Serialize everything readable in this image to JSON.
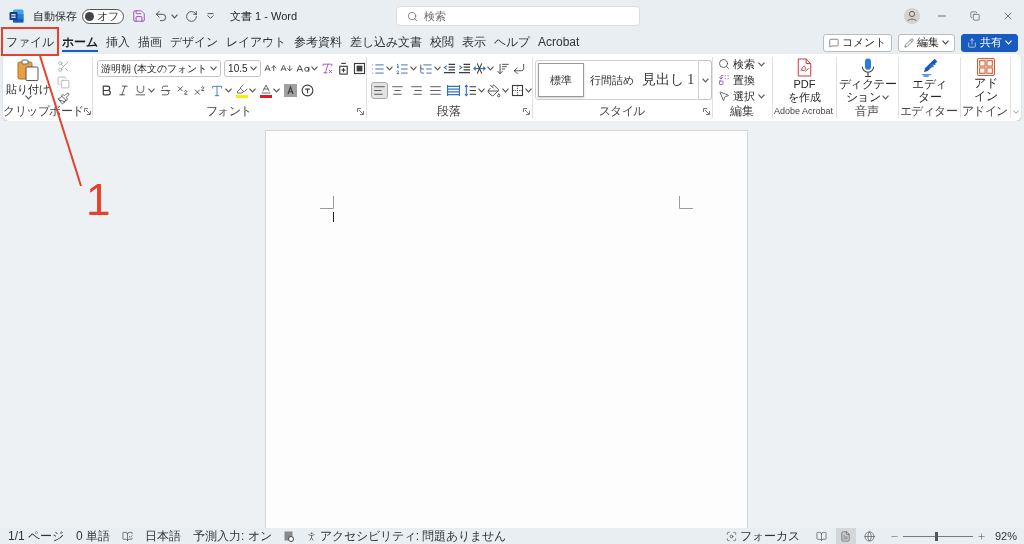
{
  "title_bar": {
    "autosave": {
      "label": "自動保存",
      "on": false,
      "state_text": "オフ"
    },
    "document_title": "文書 1 - Word",
    "search": {
      "placeholder": "検索"
    }
  },
  "tabs": [
    {
      "label": "ファイル",
      "selected": false
    },
    {
      "label": "ホーム",
      "selected": true
    },
    {
      "label": "挿入",
      "selected": false
    },
    {
      "label": "描画",
      "selected": false
    },
    {
      "label": "デザイン",
      "selected": false
    },
    {
      "label": "レイアウト",
      "selected": false
    },
    {
      "label": "参考資料",
      "selected": false
    },
    {
      "label": "差し込み文書",
      "selected": false
    },
    {
      "label": "校閲",
      "selected": false
    },
    {
      "label": "表示",
      "selected": false
    },
    {
      "label": "ヘルプ",
      "selected": false
    },
    {
      "label": "Acrobat",
      "selected": false
    }
  ],
  "header_buttons": [
    {
      "kind": "comment",
      "label": "コメント"
    },
    {
      "kind": "edit",
      "label": "編集"
    },
    {
      "kind": "share",
      "label": "共有"
    }
  ],
  "ribbon": {
    "clipboard": {
      "paste": "貼り付け",
      "tools": [
        {
          "kind": "cut",
          "disabled": true
        },
        {
          "kind": "copy",
          "disabled": true
        },
        {
          "kind": "format_painter",
          "disabled": false
        }
      ],
      "label": "クリップボード"
    },
    "font": {
      "font_name": "游明朝 (本文のフォント",
      "font_size": "10.5",
      "label": "フォント"
    },
    "paragraph": {
      "alignments": [
        {
          "kind": "left",
          "selected": true
        },
        {
          "kind": "center",
          "selected": false
        },
        {
          "kind": "right",
          "selected": false
        },
        {
          "kind": "justify",
          "selected": false
        },
        {
          "kind": "distributed",
          "selected": false
        }
      ],
      "label": "段落"
    },
    "styles": {
      "items": [
        {
          "kind": "normal",
          "label": "標準",
          "selected": true
        },
        {
          "kind": "no_spacing",
          "label": "行間詰め",
          "selected": false
        },
        {
          "kind": "heading",
          "label": "見出し 1",
          "selected": false
        }
      ],
      "label": "スタイル"
    },
    "editing": {
      "items": [
        {
          "kind": "find",
          "label": "検索"
        },
        {
          "kind": "replace",
          "label": "置換"
        },
        {
          "kind": "select",
          "label": "選択"
        }
      ],
      "label": "編集"
    },
    "app_groups": [
      {
        "kind": "pdf",
        "lines": [
          "PDF",
          "を作成"
        ],
        "label": "Adobe Acrobat"
      },
      {
        "kind": "dictation",
        "lines": [
          "ディクテー",
          "ション"
        ],
        "label": "音声"
      },
      {
        "kind": "editor",
        "lines": [
          "エディ",
          "ター"
        ],
        "label": "エディター"
      },
      {
        "kind": "addins",
        "lines": [
          "アド",
          "イン"
        ],
        "label": "アドイン"
      }
    ]
  },
  "status_bar": {
    "items": [
      {
        "kind": "page_count",
        "text": "1/1 ページ"
      },
      {
        "kind": "word_count",
        "text": "0 単語"
      },
      {
        "kind": "proofing"
      },
      {
        "kind": "language",
        "text": "日本語"
      },
      {
        "kind": "text_prediction",
        "text": "予測入力: オン"
      },
      {
        "kind": "macro"
      },
      {
        "kind": "accessibility",
        "text": "アクセシビリティ: 問題ありません"
      }
    ],
    "focus": "フォーカス",
    "views": [
      {
        "kind": "read",
        "selected": false
      },
      {
        "kind": "print",
        "selected": true
      },
      {
        "kind": "web",
        "selected": false
      }
    ],
    "zoom": {
      "level": 0.48,
      "reading": "92%"
    }
  },
  "annotation": {
    "number": "1"
  }
}
